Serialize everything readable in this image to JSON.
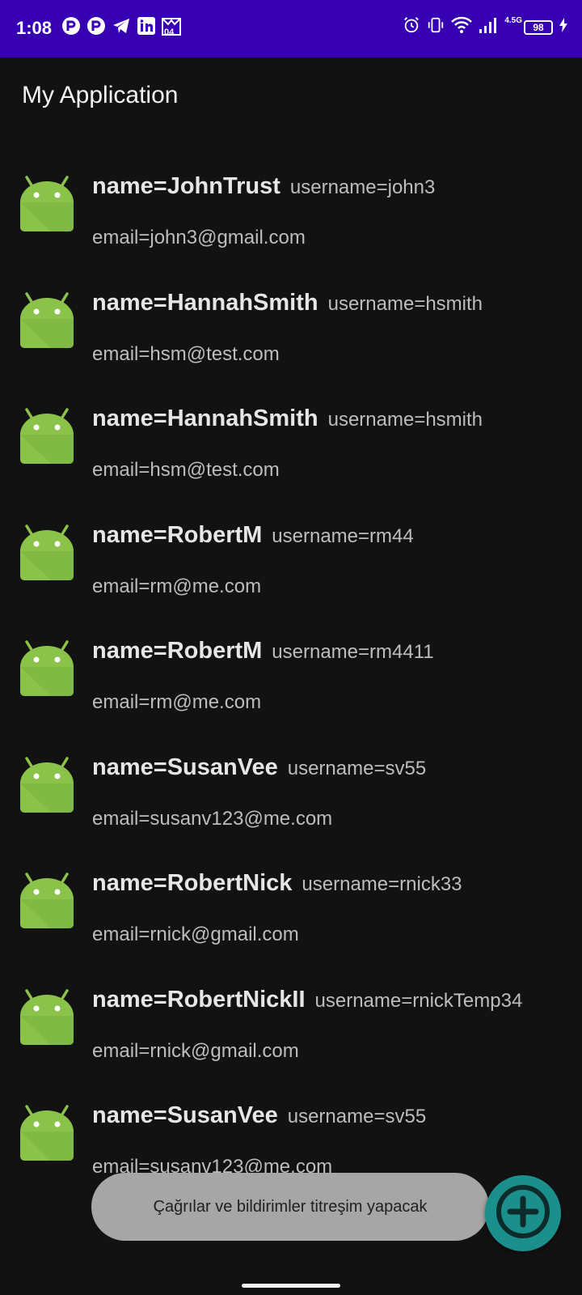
{
  "status_bar": {
    "time": "1:08",
    "left_icons": [
      "app-r-icon",
      "app-r-icon",
      "telegram-icon",
      "linkedin-icon",
      "calendar-icon"
    ],
    "calendar_day": "04",
    "network": "4.5G",
    "battery": "98",
    "right_icons": [
      "alarm-icon",
      "vibrate-icon",
      "wifi-icon",
      "signal-icon",
      "battery-icon",
      "charging-icon"
    ]
  },
  "app_bar": {
    "title": "My Application"
  },
  "users": [
    {
      "name": "name=JohnTrust",
      "username": "username=john3",
      "email": "email=john3@gmail.com"
    },
    {
      "name": "name=HannahSmith",
      "username": "username=hsmith",
      "email": "email=hsm@test.com"
    },
    {
      "name": "name=HannahSmith",
      "username": "username=hsmith",
      "email": "email=hsm@test.com"
    },
    {
      "name": "name=RobertM",
      "username": "username=rm44",
      "email": "email=rm@me.com"
    },
    {
      "name": "name=RobertM",
      "username": "username=rm4411",
      "email": "email=rm@me.com"
    },
    {
      "name": "name=SusanVee",
      "username": "username=sv55",
      "email": "email=susanv123@me.com"
    },
    {
      "name": "name=RobertNick",
      "username": "username=rnick33",
      "email": "email=rnick@gmail.com"
    },
    {
      "name": "name=RobertNickII",
      "username": "username=rnickTemp34",
      "email": "email=rnick@gmail.com"
    },
    {
      "name": "name=SusanVee",
      "username": "username=sv55",
      "email": "email=susanv123@me.com"
    }
  ],
  "toast": {
    "text": "Çağrılar ve bildirimler titreşim yapacak"
  },
  "fab": {
    "icon": "add-circle-icon"
  },
  "colors": {
    "status_bar": "#3700b3",
    "background": "#121212",
    "android_green": "#8bc34a",
    "fab": "#1a8f8c",
    "toast": "#a6a6a6"
  }
}
